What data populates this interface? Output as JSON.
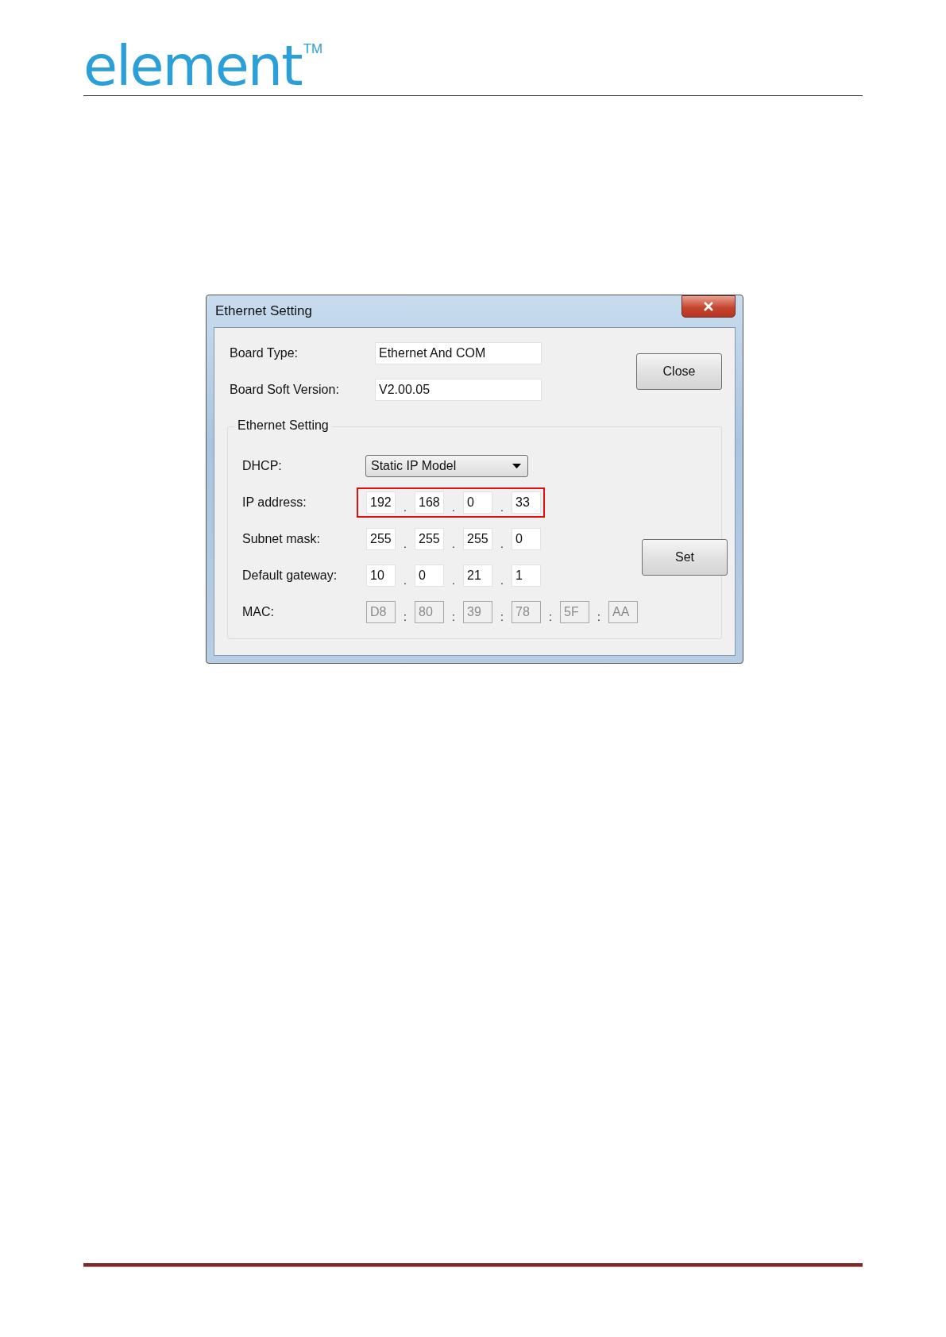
{
  "logo": {
    "text": "element",
    "mark": "TM"
  },
  "dialog": {
    "title": "Ethernet Setting",
    "info": [
      {
        "label": "Board Type:",
        "value": "Ethernet And COM"
      },
      {
        "label": "Board Soft Version:",
        "value": "V2.00.05"
      }
    ],
    "close_button": "Close",
    "group": {
      "title": "Ethernet Setting",
      "dhcp": {
        "label": "DHCP:",
        "value": "Static IP Model"
      },
      "rows": [
        {
          "label": "IP address:",
          "separator": ".",
          "highlighted": true,
          "disabled": false,
          "octets": [
            "192",
            "168",
            "0",
            "33"
          ]
        },
        {
          "label": "Subnet mask:",
          "separator": ".",
          "highlighted": false,
          "disabled": false,
          "octets": [
            "255",
            "255",
            "255",
            "0"
          ]
        },
        {
          "label": "Default gateway:",
          "separator": ".",
          "highlighted": false,
          "disabled": false,
          "octets": [
            "10",
            "0",
            "21",
            "1"
          ]
        },
        {
          "label": "MAC:",
          "separator": ":",
          "highlighted": false,
          "disabled": true,
          "octets": [
            "D8",
            "80",
            "39",
            "78",
            "5F",
            "AA"
          ]
        }
      ],
      "set_button": "Set"
    }
  }
}
